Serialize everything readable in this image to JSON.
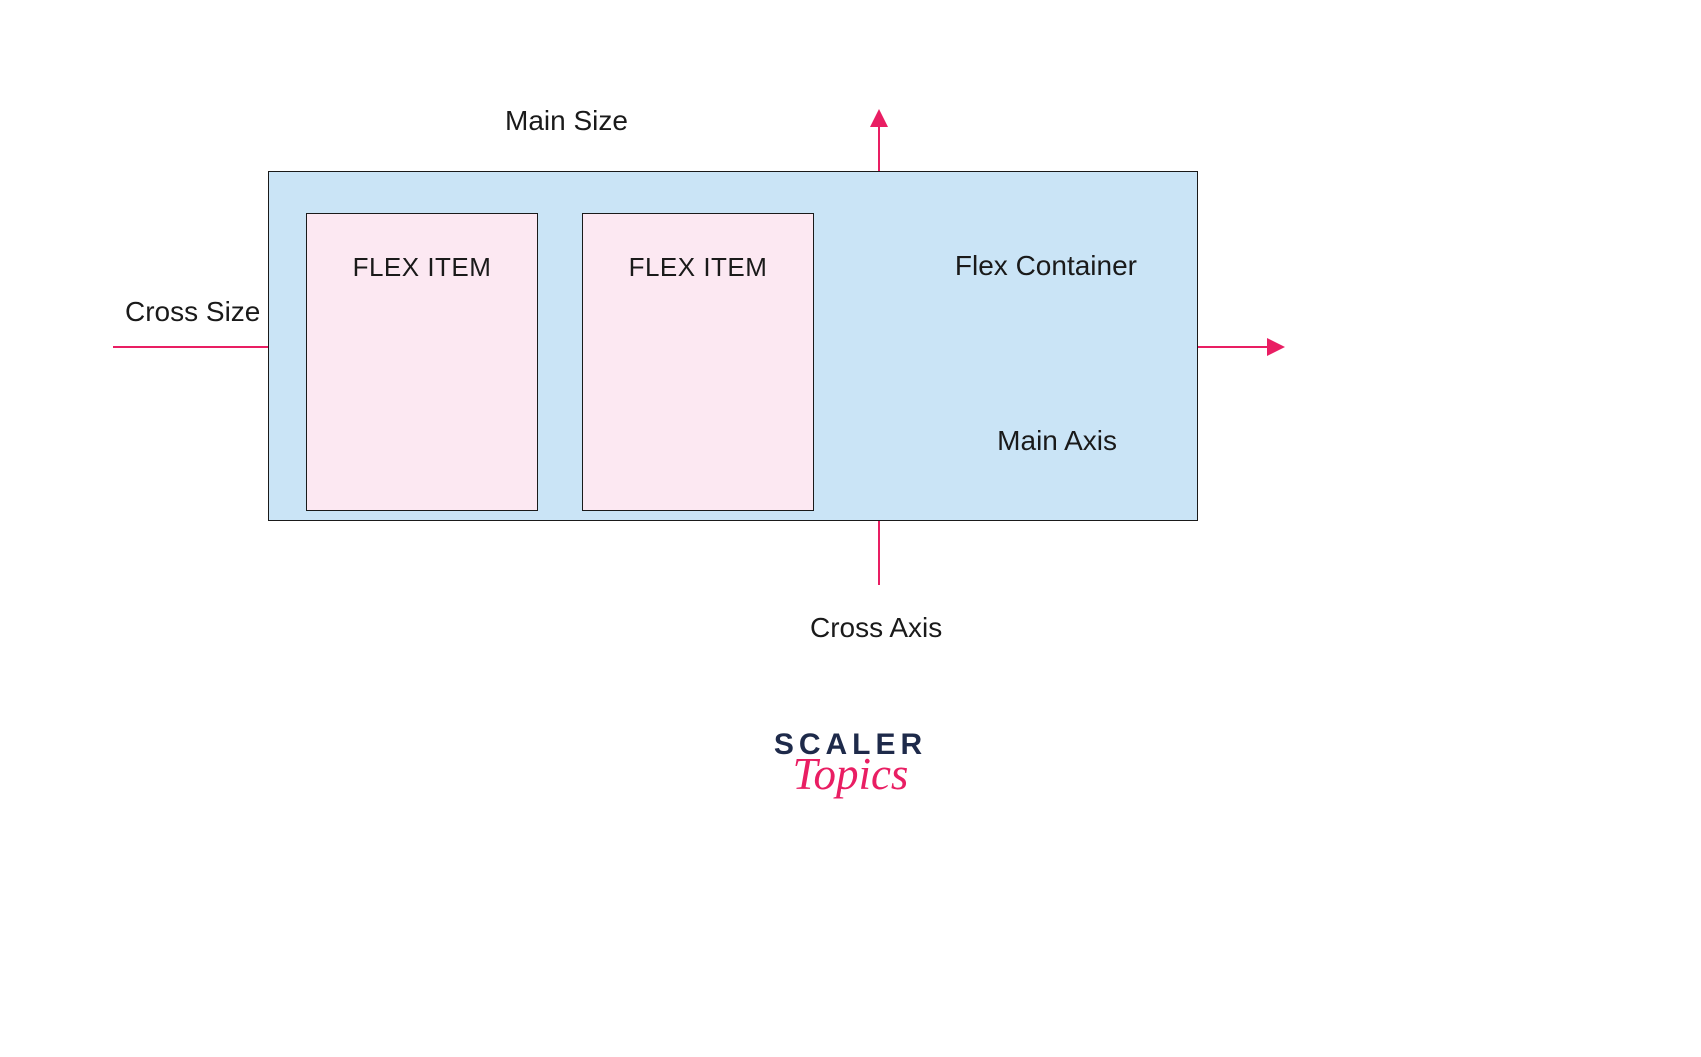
{
  "labels": {
    "main_size": "Main Size",
    "cross_size": "Cross Size",
    "cross_axis": "Cross Axis",
    "main_axis": "Main Axis",
    "flex_container": "Flex Container",
    "flex_item": "FLEX ITEM"
  },
  "logo": {
    "brand": "SCALER",
    "sub": "Topics"
  },
  "colors": {
    "container_bg": "#cae4f6",
    "item_bg": "#fce8f2",
    "axis": "#e91e63",
    "text": "#1a1a1a",
    "logo_primary": "#1e2a4a",
    "logo_accent": "#e91e63"
  }
}
